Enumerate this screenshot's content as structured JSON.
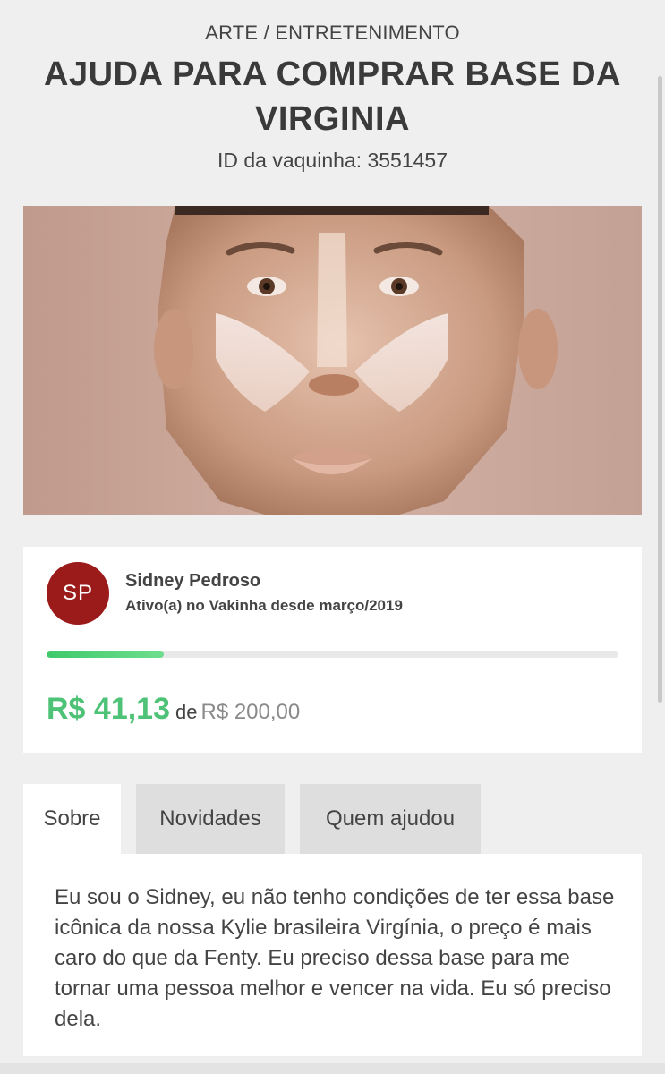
{
  "header": {
    "category": "ARTE / ENTRETENIMENTO",
    "title": "AJUDA PARA COMPRAR BASE DA VIRGINIA",
    "campaign_id_text": "ID da vaquinha: 3551457"
  },
  "hero_image": {
    "subject": "face with contour makeup"
  },
  "organizer": {
    "initials": "SP",
    "avatar_color": "#9b1b1b",
    "name": "Sidney Pedroso",
    "since": "Ativo(a) no Vakinha desde março/2019"
  },
  "funding": {
    "raised": "R$ 41,13",
    "of_word": "de",
    "goal": "R$ 200,00",
    "progress_fraction": 0.2057,
    "accent_color": "#4ec377"
  },
  "tabs": [
    {
      "label": "Sobre",
      "active": true
    },
    {
      "label": "Novidades",
      "active": false
    },
    {
      "label": "Quem ajudou",
      "active": false
    }
  ],
  "about": {
    "text": "Eu sou o Sidney, eu não tenho condições de ter essa base icônica da nossa Kylie brasileira Virgínia, o preço é mais caro do que da Fenty. Eu preciso dessa base para me tornar uma pessoa melhor e vencer na vida. Eu só preciso dela."
  }
}
